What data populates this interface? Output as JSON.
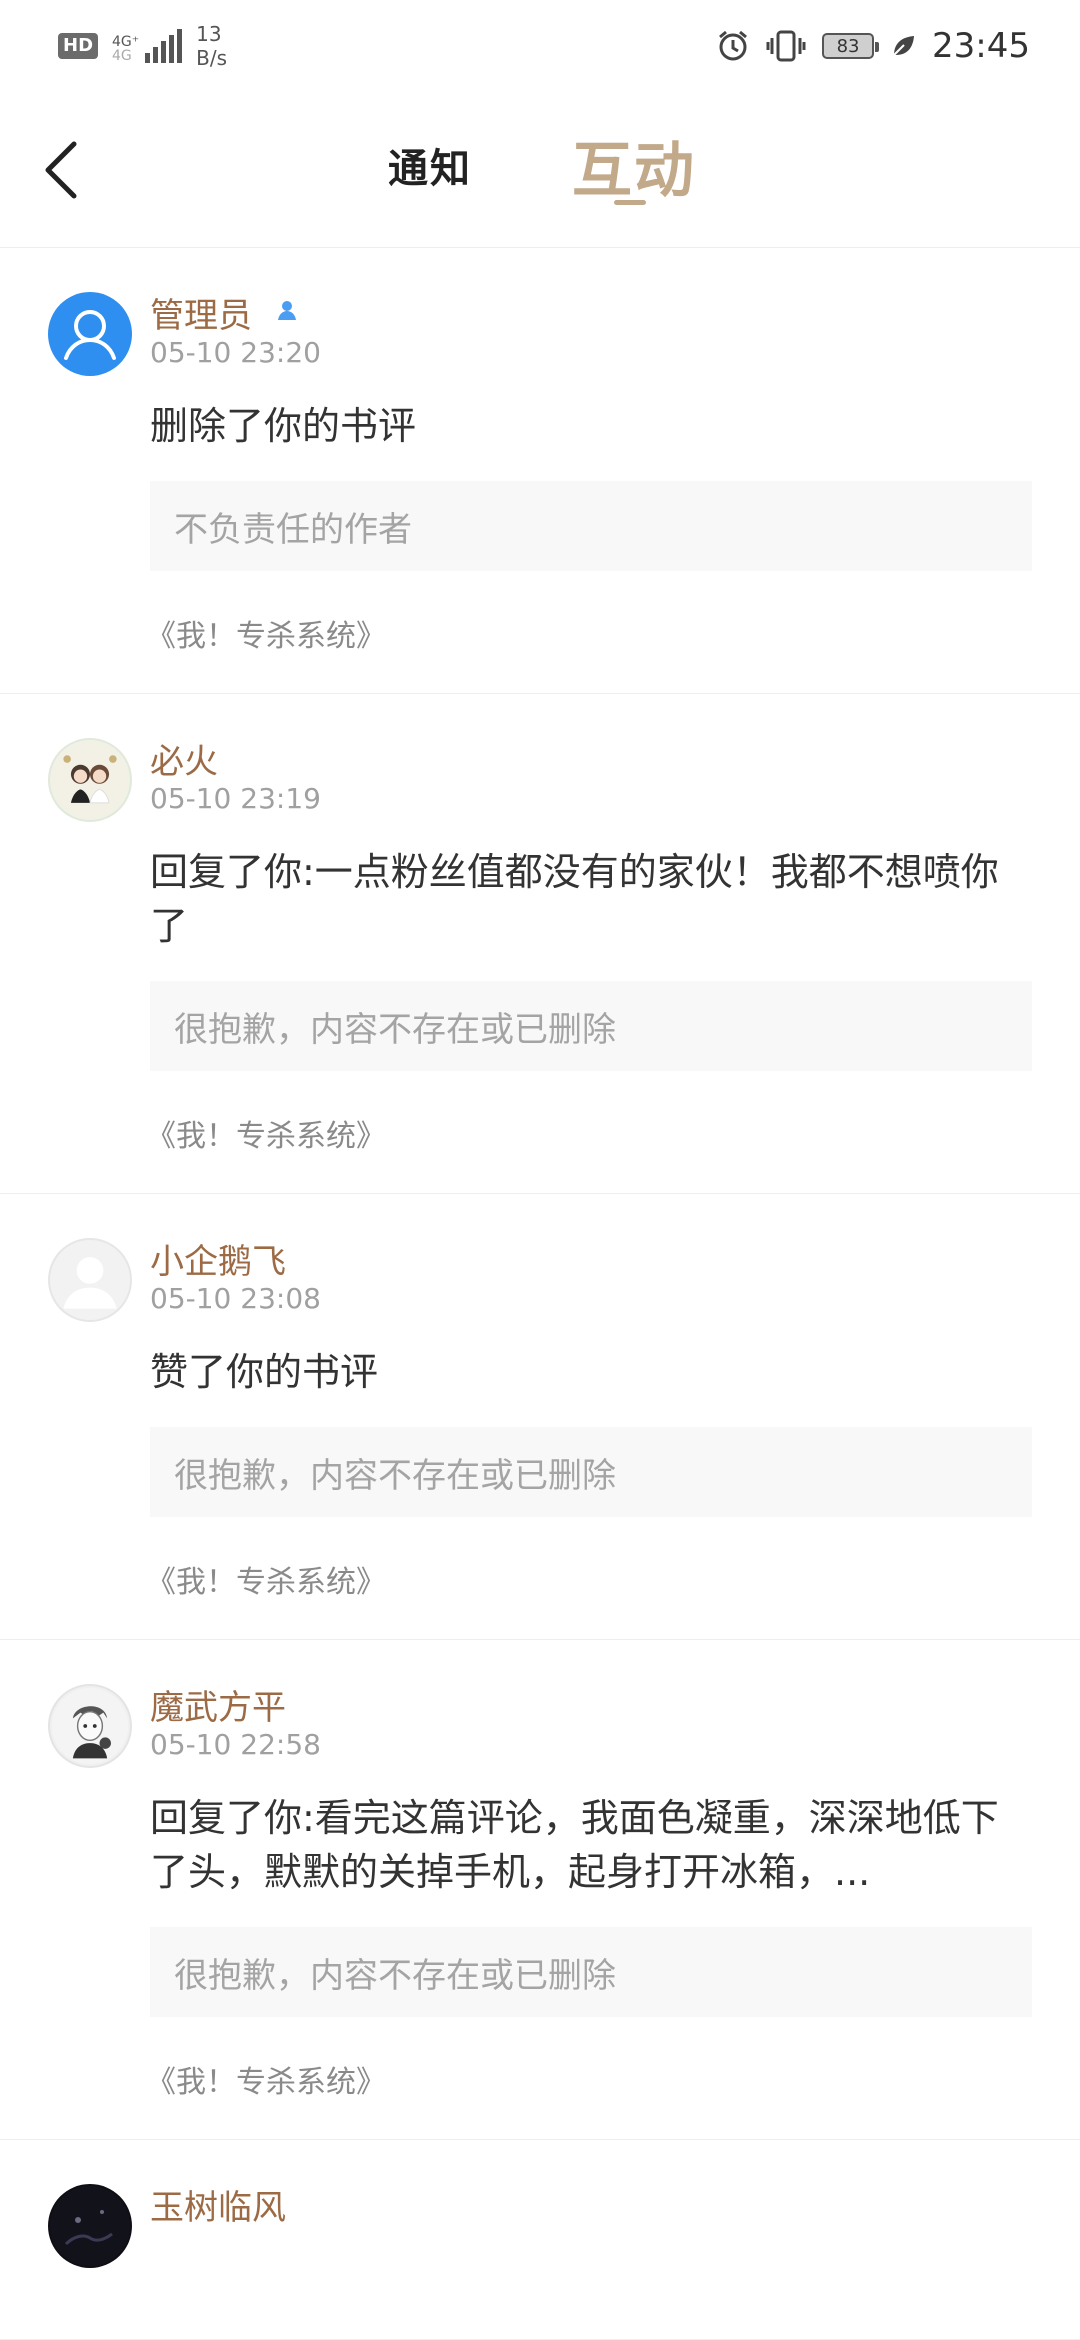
{
  "status_bar": {
    "hd": "HD",
    "network": "4G⁺",
    "network_sub": "4G",
    "speed_value": "13",
    "speed_unit": "B/s",
    "battery": "83",
    "time": "23:45"
  },
  "nav": {
    "tab_notify": "通知",
    "tab_interact": "互动"
  },
  "items": [
    {
      "name": "管理员",
      "time": "05-10 23:20",
      "action": "删除了你的书评",
      "quote": "不负责任的作者",
      "book": "《我！专杀系统》"
    },
    {
      "name": "必火",
      "time": "05-10 23:19",
      "action": "回复了你:一点粉丝值都没有的家伙！我都不想喷你了",
      "quote": "很抱歉，内容不存在或已删除",
      "book": "《我！专杀系统》"
    },
    {
      "name": "小企鹅飞",
      "time": "05-10 23:08",
      "action": "赞了你的书评",
      "quote": "很抱歉，内容不存在或已删除",
      "book": "《我！专杀系统》"
    },
    {
      "name": "魔武方平",
      "time": "05-10 22:58",
      "action": "回复了你:看完这篇评论，我面色凝重，深深地低下了头，默默的关掉手机，起身打开冰箱，...",
      "quote": "很抱歉，内容不存在或已删除",
      "book": "《我！专杀系统》"
    },
    {
      "name": "玉树临风"
    }
  ]
}
